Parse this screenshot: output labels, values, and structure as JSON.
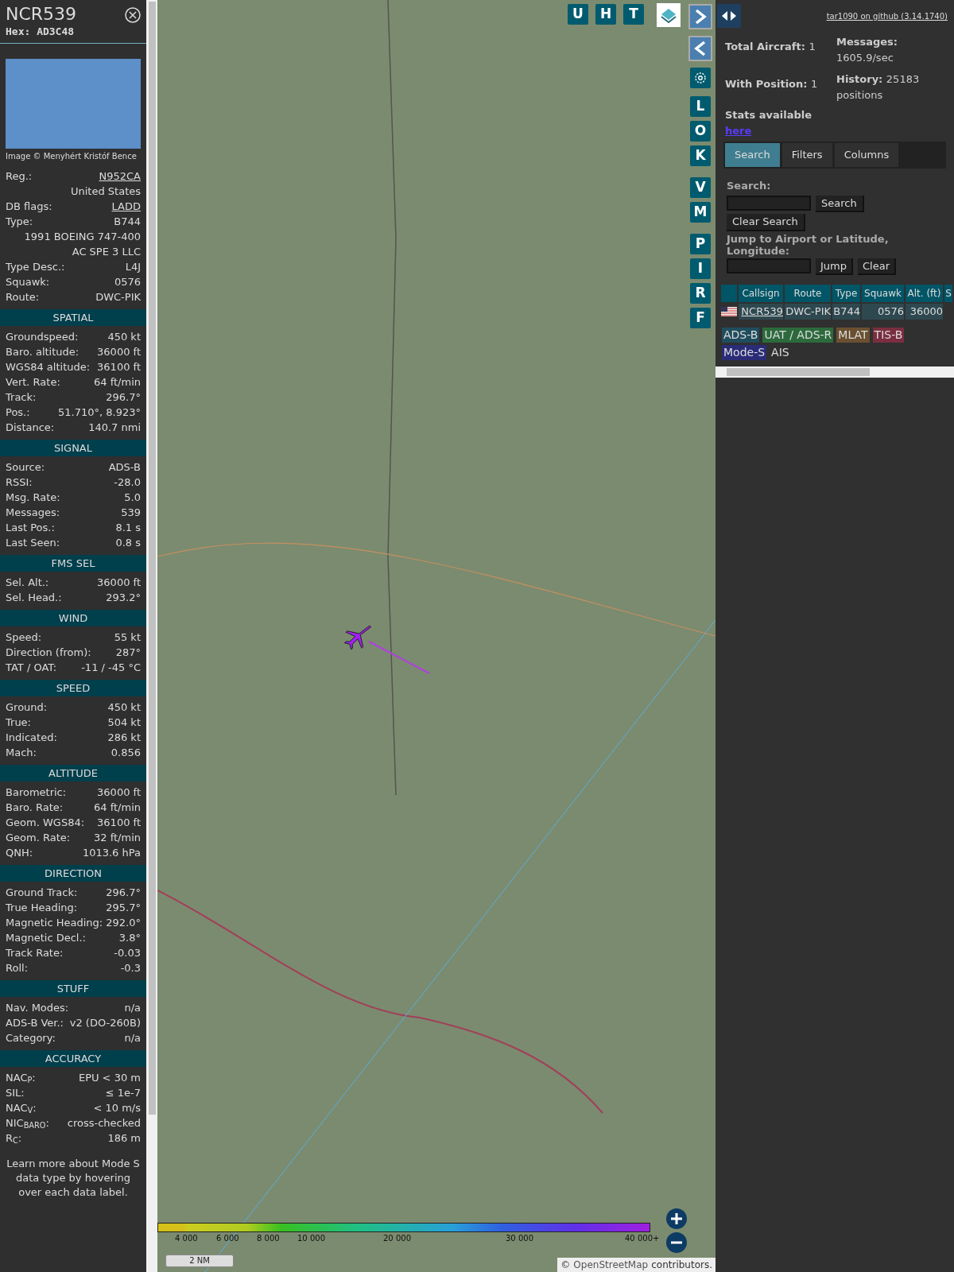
{
  "aircraft": {
    "callsign": "NCR539",
    "hex": "Hex: AD3C48",
    "photo_credit": "Image © Menyhért Kristóf Bence",
    "info": [
      {
        "label": "Reg.:",
        "value": "N952CA",
        "link": true
      },
      {
        "value": "United States",
        "link": false
      },
      {
        "label": "DB flags:",
        "value": "LADD",
        "link": true
      },
      {
        "label": "Type:",
        "value": "B744",
        "link": false
      },
      {
        "value": "1991 BOEING 747-400",
        "link": false
      },
      {
        "value": "AC SPE 3 LLC",
        "link": false
      },
      {
        "label": "Type Desc.:",
        "value": "L4J",
        "link": false
      },
      {
        "label": "Squawk:",
        "value": "0576",
        "link": false
      },
      {
        "label": "Route:",
        "value": "DWC-PIK",
        "link": false
      }
    ]
  },
  "sections": [
    {
      "title": "SPATIAL",
      "rows": [
        [
          "Groundspeed:",
          "450 kt"
        ],
        [
          "Baro. altitude:",
          "36000 ft"
        ],
        [
          "WGS84 altitude:",
          "36100 ft"
        ],
        [
          "Vert. Rate:",
          "64 ft/min"
        ],
        [
          "Track:",
          "296.7°"
        ],
        [
          "Pos.:",
          "51.710°, 8.923°"
        ],
        [
          "Distance:",
          "140.7 nmi"
        ]
      ]
    },
    {
      "title": "SIGNAL",
      "rows": [
        [
          "Source:",
          "ADS-B"
        ],
        [
          "RSSI:",
          "-28.0"
        ],
        [
          "Msg. Rate:",
          "5.0"
        ],
        [
          "Messages:",
          "539"
        ],
        [
          "Last Pos.:",
          "8.1 s"
        ],
        [
          "Last Seen:",
          "0.8 s"
        ]
      ]
    },
    {
      "title": "FMS SEL",
      "rows": [
        [
          "Sel. Alt.:",
          "36000 ft"
        ],
        [
          "Sel. Head.:",
          "293.2°"
        ]
      ]
    },
    {
      "title": "WIND",
      "rows": [
        [
          "Speed:",
          "55 kt"
        ],
        [
          "Direction (from):",
          "287°"
        ],
        [
          "TAT / OAT:",
          "-11 / -45 °C"
        ]
      ]
    },
    {
      "title": "SPEED",
      "rows": [
        [
          "Ground:",
          "450 kt"
        ],
        [
          "True:",
          "504 kt"
        ],
        [
          "Indicated:",
          "286 kt"
        ],
        [
          "Mach:",
          "0.856"
        ]
      ]
    },
    {
      "title": "ALTITUDE",
      "rows": [
        [
          "Barometric:",
          "36000 ft"
        ],
        [
          "Baro. Rate:",
          "64 ft/min"
        ],
        [
          "Geom. WGS84:",
          "36100 ft"
        ],
        [
          "Geom. Rate:",
          "32 ft/min"
        ],
        [
          "QNH:",
          "1013.6 hPa"
        ]
      ]
    },
    {
      "title": "DIRECTION",
      "rows": [
        [
          "Ground Track:",
          "296.7°"
        ],
        [
          "True Heading:",
          "295.7°"
        ],
        [
          "Magnetic Heading:",
          "292.0°"
        ],
        [
          "Magnetic Decl.:",
          "3.8°"
        ],
        [
          "Track Rate:",
          "-0.03"
        ],
        [
          "Roll:",
          "-0.3"
        ]
      ]
    },
    {
      "title": "STUFF",
      "rows": [
        [
          "Nav. Modes:",
          "n/a"
        ],
        [
          "ADS-B Ver.:",
          "v2 (DO-260B)"
        ],
        [
          "Category:",
          "n/a"
        ]
      ]
    },
    {
      "title": "ACCURACY",
      "rows": [
        [
          "NAC$_{P}$:",
          "EPU < 30 m"
        ],
        [
          "SIL:",
          "≤ 1e-7"
        ],
        [
          "NAC$_{V}$:",
          "< 10 m/s"
        ],
        [
          "NIC$_{BARO}$:",
          "cross-checked"
        ],
        [
          "R$_{C}$:",
          "186 m"
        ]
      ]
    }
  ],
  "footnote": "Learn more about Mode S data type by hovering over each data label.",
  "map": {
    "top_buttons": [
      "U",
      "H",
      "T"
    ],
    "side_buttons": [
      "L",
      "O",
      "K",
      "V",
      "M",
      "P",
      "I",
      "R",
      "F"
    ],
    "legend": [
      "4 000",
      "6 000",
      "8 000",
      "10 000",
      "20 000",
      "30 000",
      "40 000+"
    ],
    "scale": "2 NM",
    "attribution_prefix": "©",
    "attribution_link": "OpenStreetMap",
    "attribution_suffix": "contributors."
  },
  "right": {
    "github": "tar1090 on github (3.14.1740)",
    "stats": [
      {
        "label": "Total Aircraft:",
        "value": "1"
      },
      {
        "label": "Messages:",
        "value": "1605.9/sec"
      },
      {
        "label": "With Position:",
        "value": "1"
      },
      {
        "label": "History:",
        "value": "25183 positions"
      }
    ],
    "stats_link_text": "Stats available",
    "stats_link": "here",
    "tabs": [
      {
        "label": "Search",
        "selected": true
      },
      {
        "label": "Filters",
        "selected": false
      },
      {
        "label": "Columns",
        "selected": false
      }
    ],
    "search_label": "Search:",
    "search_button": "Search",
    "clear_search": "Clear Search",
    "jump_label": "Jump to Airport or Latitude, Longitude:",
    "jump_button": "Jump",
    "clear_button": "Clear",
    "table": {
      "columns": [
        "Callsign",
        "Route",
        "Type",
        "Squawk",
        "Alt. (ft)",
        "S"
      ],
      "rows": [
        [
          "NCR539",
          "DWC-PIK",
          "B744",
          "0576",
          "36000"
        ]
      ]
    },
    "sources": [
      {
        "label": "ADS-B",
        "color": "#1f4d5e"
      },
      {
        "label": "UAT / ADS-R",
        "color": "#2c6a3c"
      },
      {
        "label": "MLAT",
        "color": "#6a5030"
      },
      {
        "label": "TIS-B",
        "color": "#7a2e40"
      },
      {
        "label": "Mode-S",
        "color": "#2a2c78"
      },
      {
        "label": "AIS",
        "color": "#303030"
      }
    ]
  }
}
